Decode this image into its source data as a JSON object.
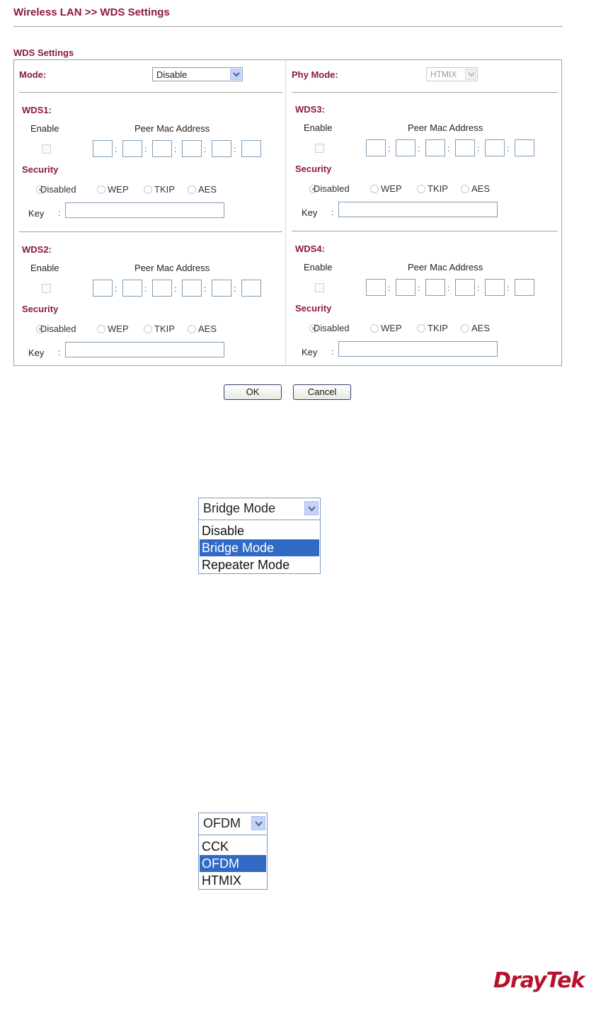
{
  "page": {
    "title": "Wireless LAN >> WDS Settings"
  },
  "panel": {
    "title": "WDS Settings"
  },
  "mode": {
    "label": "Mode:",
    "value": "Disable"
  },
  "phy_mode": {
    "label": "Phy Mode:",
    "value": "HTMIX"
  },
  "common": {
    "enable_label": "Enable",
    "peer_mac_label": "Peer Mac Address",
    "security_label": "Security",
    "key_label": "Key",
    "key_colon": ":",
    "mac_sep": ":",
    "security_options": [
      "Disabled",
      "WEP",
      "TKIP",
      "AES"
    ],
    "security_selected": "Disabled"
  },
  "wds": [
    {
      "label": "WDS1:"
    },
    {
      "label": "WDS2:"
    },
    {
      "label": "WDS3:"
    },
    {
      "label": "WDS4:"
    }
  ],
  "buttons": {
    "ok": "OK",
    "cancel": "Cancel"
  },
  "mode_dropdown": {
    "selected": "Bridge Mode",
    "options": [
      "Disable",
      "Bridge Mode",
      "Repeater Mode"
    ],
    "highlighted": "Bridge Mode"
  },
  "phy_dropdown": {
    "selected": "OFDM",
    "options": [
      "CCK",
      "OFDM",
      "HTMIX"
    ],
    "highlighted": "OFDM"
  },
  "logo": {
    "text": "DrayTek"
  },
  "colors": {
    "label": "#8b1a3e",
    "highlight": "#316ac5",
    "logo": "#b5122b"
  }
}
